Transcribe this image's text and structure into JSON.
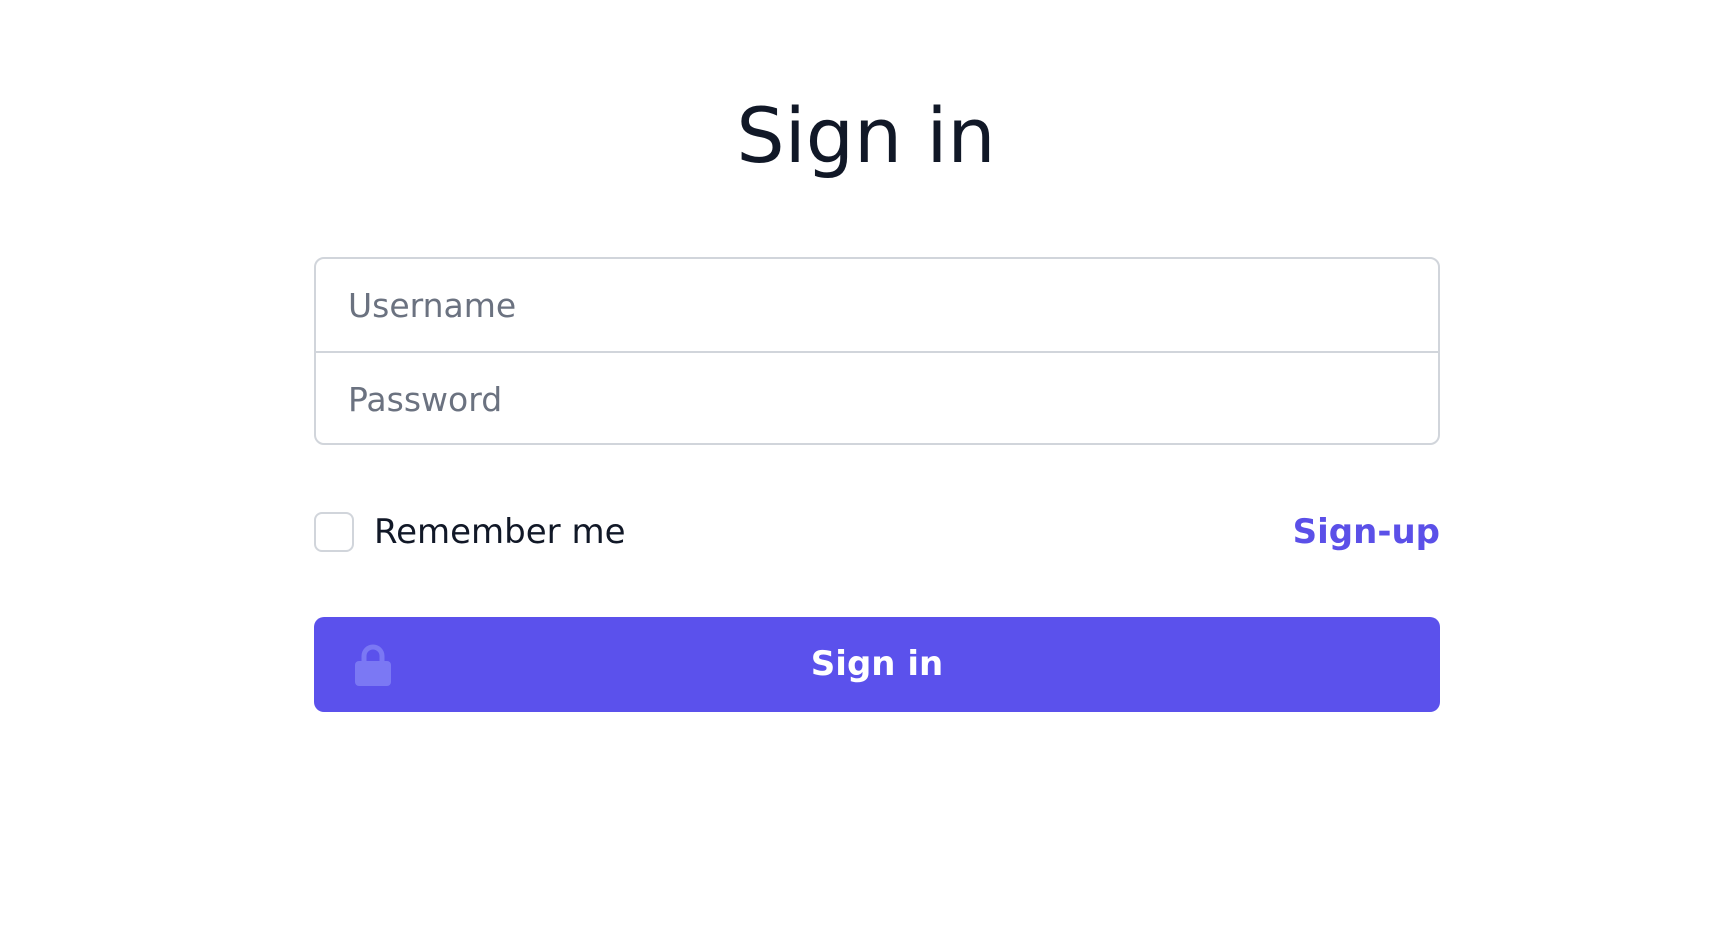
{
  "heading": "Sign in",
  "form": {
    "username_placeholder": "Username",
    "password_placeholder": "Password",
    "remember_label": "Remember me",
    "remember_checked": false,
    "signup_link": "Sign-up",
    "submit_label": "Sign in"
  },
  "icons": {
    "submit_icon": "lock-icon"
  },
  "colors": {
    "accent": "#5b51ec",
    "link": "#5b50e8",
    "lock_icon": "#7b78f4",
    "border": "#d1d5db",
    "placeholder": "#6b7280"
  }
}
